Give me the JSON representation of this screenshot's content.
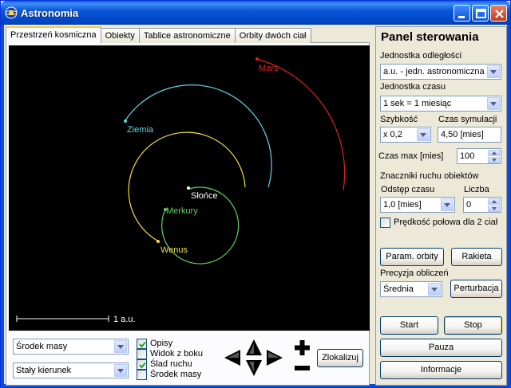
{
  "window": {
    "title": "Astronomia"
  },
  "tabs": [
    {
      "label": "Przestrzeń kosmiczna",
      "active": true
    },
    {
      "label": "Obiekty",
      "active": false
    },
    {
      "label": "Tablice astronomiczne",
      "active": false
    },
    {
      "label": "Orbity dwóch ciał",
      "active": false
    }
  ],
  "space": {
    "sun_label": "Słońce",
    "planets": [
      {
        "name": "Merkury",
        "color": "#5fd35f"
      },
      {
        "name": "Wenus",
        "color": "#f0e040"
      },
      {
        "name": "Ziemia",
        "color": "#5fd8e8"
      },
      {
        "name": "Mars",
        "color": "#e02020"
      }
    ],
    "scale_label": "1 a.u."
  },
  "bottom": {
    "center_combo": "Środek masy",
    "direction_combo": "Stały kierunek",
    "checkboxes": [
      {
        "label": "Opisy",
        "checked": true
      },
      {
        "label": "Widok z boku",
        "checked": false
      },
      {
        "label": "Ślad ruchu",
        "checked": true
      },
      {
        "label": "Środek masy",
        "checked": false
      }
    ],
    "zoom_in": "+",
    "zoom_out": "−",
    "locate_button": "Zlokalizuj"
  },
  "panel": {
    "title": "Panel sterowania",
    "distance_unit_label": "Jednostka odległości",
    "distance_unit_value": "a.u. - jedn. astronomiczna",
    "time_unit_label": "Jednostka czasu",
    "time_unit_value": "1 sek = 1 miesiąc",
    "speed_label": "Szybkość",
    "speed_value": "x 0,2",
    "sim_time_label": "Czas symulacji",
    "sim_time_value": "4,50 [mies]",
    "max_time_label": "Czas max [mies]",
    "max_time_value": "100",
    "markers_label": "Znaczniki ruchu obiektów",
    "interval_label": "Odstęp czasu",
    "interval_value": "1,0 [mies]",
    "count_label": "Liczba",
    "count_value": "0",
    "half_speed_label": "Prędkość połowa dla 2 ciał",
    "half_speed_checked": false,
    "orbit_params_button": "Param. orbity",
    "rocket_button": "Rakieta",
    "precision_label": "Precyzja obliczeń",
    "precision_value": "Średnia",
    "perturbation_button": "Perturbacja",
    "start_button": "Start",
    "stop_button": "Stop",
    "pause_button": "Pauza",
    "info_button": "Informacje"
  }
}
